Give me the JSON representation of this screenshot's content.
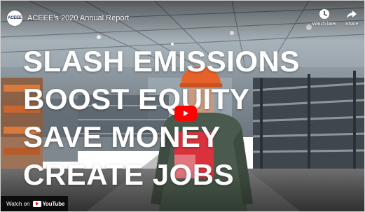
{
  "player": {
    "channel_avatar_text": "ACEEE",
    "title": "ACEEE's 2020 Annual Report",
    "watch_later_label": "Watch later",
    "share_label": "Share"
  },
  "headline": {
    "lines": [
      "SLASH EMISSIONS",
      "BOOST EQUITY",
      "SAVE MONEY",
      "CREATE JOBS"
    ]
  },
  "footer": {
    "watch_on_label": "Watch on",
    "youtube_label": "YouTube"
  },
  "colors": {
    "play_button": "#ff0000",
    "helmet": "#e5622a",
    "shirt_accent": "#d9323c"
  },
  "icons": {
    "watch_later": "clock-icon",
    "share": "share-arrow-icon",
    "play": "play-icon",
    "youtube_logo": "youtube-logo"
  }
}
